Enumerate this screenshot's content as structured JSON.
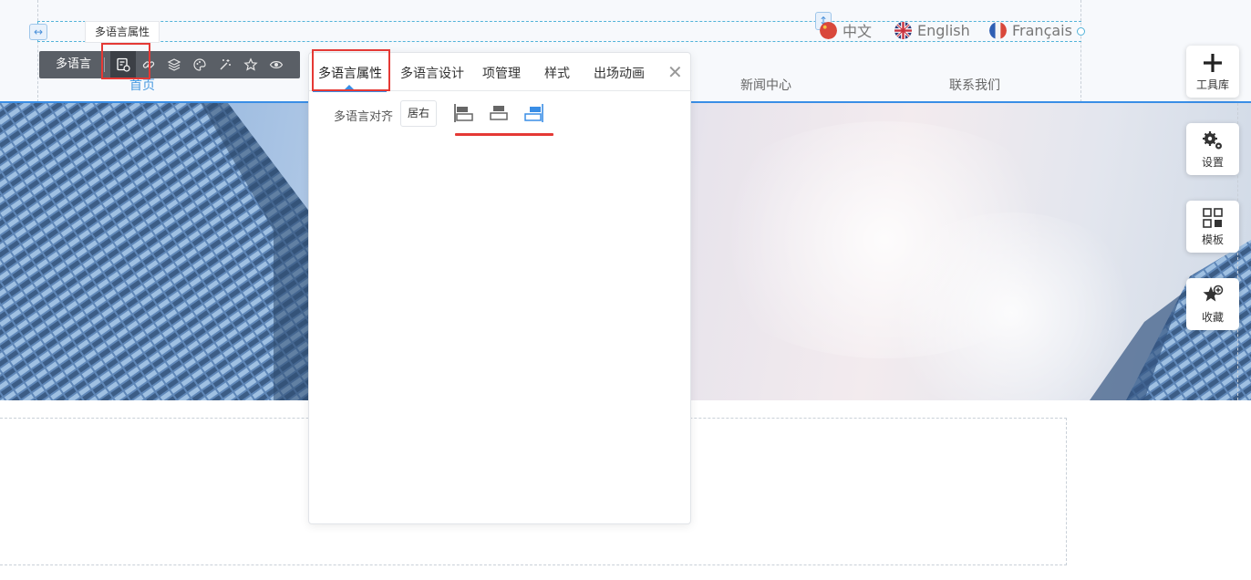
{
  "header": {
    "breadcrumb": "多语言属性",
    "languages": [
      {
        "label": "中文",
        "flag": "china-flag-icon"
      },
      {
        "label": "English",
        "flag": "uk-flag-icon"
      },
      {
        "label": "Français",
        "flag": "france-flag-icon"
      }
    ],
    "nav": [
      {
        "label": "首页",
        "active": true
      },
      {
        "label": "新闻中心",
        "active": false
      },
      {
        "label": "联系我们",
        "active": false
      }
    ]
  },
  "toolbar": {
    "label": "多语言",
    "buttons": [
      "language-properties-icon",
      "link-icon",
      "layers-icon",
      "palette-icon",
      "magic-wand-icon",
      "star-icon",
      "eye-icon"
    ]
  },
  "panel": {
    "tabs": [
      "多语言属性",
      "多语言设计",
      "项管理",
      "样式",
      "出场动画"
    ],
    "active_tab": 0,
    "close_icon": "close-icon",
    "align_label": "多语言对齐",
    "align_value": "居右",
    "align_options": [
      "align-left-icon",
      "align-center-icon",
      "align-right-icon"
    ],
    "align_selected": 2
  },
  "side_tools": [
    {
      "label": "工具库",
      "icon": "plus-icon"
    },
    {
      "label": "设置",
      "icon": "gears-icon"
    },
    {
      "label": "模板",
      "icon": "template-grid-icon"
    },
    {
      "label": "收藏",
      "icon": "star-add-icon"
    }
  ],
  "colors": {
    "accent": "#3a8ee6",
    "highlight": "#e53935",
    "toolbar_bg": "#5a5f66"
  }
}
